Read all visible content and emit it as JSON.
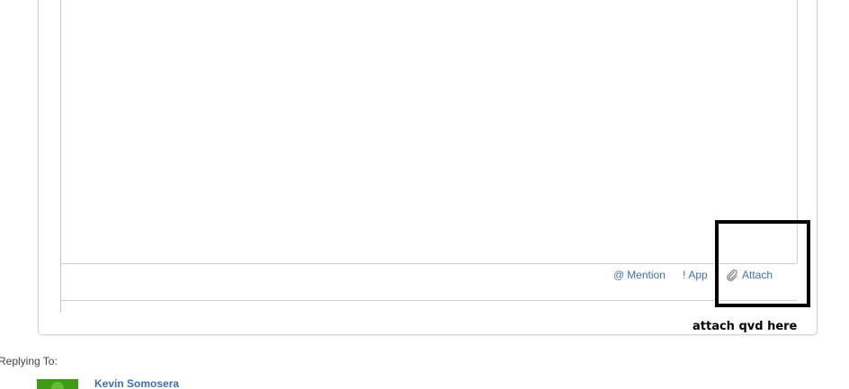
{
  "toolbar": {
    "mention": {
      "symbol": "@",
      "label": "Mention"
    },
    "app": {
      "symbol": "!",
      "label": "App"
    },
    "attach": {
      "label": "Attach",
      "icon": "paperclip-icon"
    }
  },
  "annotation": {
    "text": "attach qvd here",
    "color": "#000000"
  },
  "reply": {
    "label": "Replying To:",
    "author": "Kevin Somosera",
    "avatar_color": "#3f9a18"
  },
  "colors": {
    "link": "#3d6fb6",
    "border": "#d0d0d0"
  }
}
